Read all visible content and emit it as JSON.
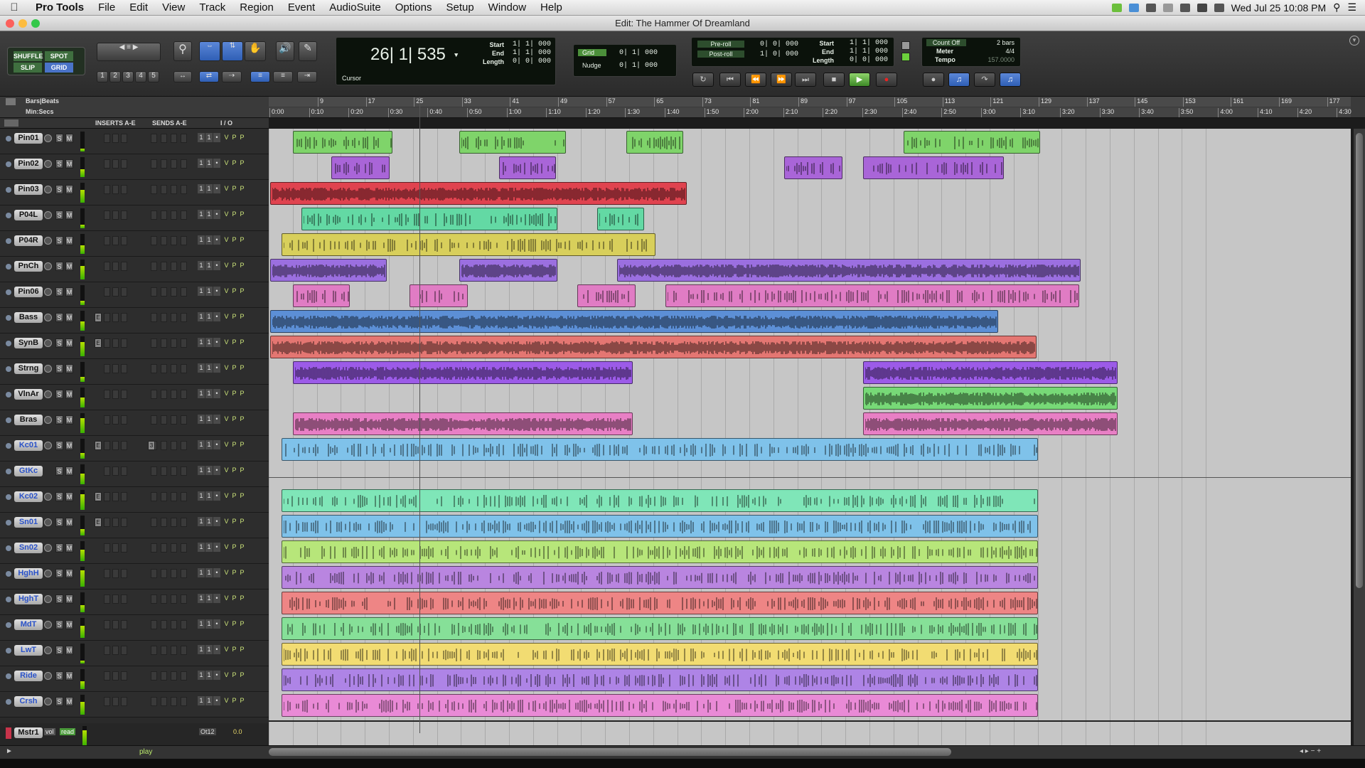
{
  "menubar": {
    "app_name": "Pro Tools",
    "items": [
      "File",
      "Edit",
      "View",
      "Track",
      "Region",
      "Event",
      "AudioSuite",
      "Options",
      "Setup",
      "Window",
      "Help"
    ],
    "clock": "Wed Jul 25  10:08 PM"
  },
  "window": {
    "title": "Edit: The Hammer Of Dreamland"
  },
  "toolbar": {
    "modes": {
      "shuffle": "SHUFFLE",
      "spot": "SPOT",
      "slip": "SLIP",
      "grid": "GRID"
    },
    "zoom_presets": [
      "1",
      "2",
      "3",
      "4",
      "5"
    ],
    "main_counter": "26| 1| 535",
    "cursor_label": "Cursor",
    "selection": {
      "start_label": "Start",
      "start": "1| 1| 000",
      "end_label": "End",
      "end": "1| 1| 000",
      "length_label": "Length",
      "length": "0| 0| 000"
    },
    "grid_label": "Grid",
    "grid_value": "0| 1| 000",
    "nudge_label": "Nudge",
    "nudge_value": "0| 1| 000",
    "preroll_label": "Pre-roll",
    "preroll": "0| 0| 000",
    "postroll_label": "Post-roll",
    "postroll": "1| 0| 000",
    "transport_sel": {
      "start_label": "Start",
      "start": "1| 1| 000",
      "end_label": "End",
      "end": "1| 1| 000",
      "length_label": "Length",
      "length": "0| 0| 000"
    },
    "count_off_label": "Count Off",
    "count_off": "2 bars",
    "meter_label": "Meter",
    "meter": "4/4",
    "tempo_label": "Tempo",
    "tempo": "157.0000"
  },
  "rulers": {
    "bars_label": "Bars|Beats",
    "mins_label": "Min:Secs",
    "bars": [
      "9",
      "17",
      "25",
      "33",
      "41",
      "49",
      "57",
      "65",
      "73",
      "81",
      "89",
      "97",
      "105",
      "113",
      "121",
      "129",
      "137",
      "145",
      "153",
      "161",
      "169",
      "177"
    ],
    "mins": [
      "0:00",
      "0:10",
      "0:20",
      "0:30",
      "0:40",
      "0:50",
      "1:00",
      "1:10",
      "1:20",
      "1:30",
      "1:40",
      "1:50",
      "2:00",
      "2:10",
      "2:20",
      "2:30",
      "2:40",
      "2:50",
      "3:00",
      "3:10",
      "3:20",
      "3:30",
      "3:40",
      "3:50",
      "4:00",
      "4:10",
      "4:20",
      "4:30"
    ]
  },
  "columns": {
    "inserts": "INSERTS A-E",
    "sends": "SENDS A-E",
    "io": "I / O"
  },
  "tracks": [
    {
      "name": "Pin01",
      "color": "#7fd46a",
      "type": "midi"
    },
    {
      "name": "Pin02",
      "color": "#a965d8",
      "type": "midi"
    },
    {
      "name": "Pin03",
      "color": "#e0434f",
      "type": "midi"
    },
    {
      "name": "P04L",
      "color": "#63d9a4",
      "type": "midi"
    },
    {
      "name": "P04R",
      "color": "#d8cf5b",
      "type": "midi"
    },
    {
      "name": "PnCh",
      "color": "#9b6fe0",
      "type": "midi"
    },
    {
      "name": "Pin06",
      "color": "#e07cc4",
      "type": "midi"
    },
    {
      "name": "Bass",
      "color": "#5c8fd6",
      "type": "audio",
      "insert": "E"
    },
    {
      "name": "SynB",
      "color": "#e47672",
      "type": "audio",
      "insert": "E"
    },
    {
      "name": "Strng",
      "color": "#9c5be8",
      "type": "audio"
    },
    {
      "name": "VlnAr",
      "color": "#77d977",
      "type": "audio"
    },
    {
      "name": "Bras",
      "color": "#e87fc5",
      "type": "audio"
    },
    {
      "name": "Kc01",
      "color": "#7fc2ea",
      "type": "inst",
      "insert": "E",
      "send": "3"
    },
    {
      "name": "GtKc",
      "color": "#8a8a8a",
      "type": "inst"
    },
    {
      "name": "Kc02",
      "color": "#7fe6b8",
      "type": "inst",
      "insert": "E"
    },
    {
      "name": "Sn01",
      "color": "#7fc2ea",
      "type": "inst",
      "insert": "E"
    },
    {
      "name": "Sn02",
      "color": "#b7e67a",
      "type": "inst"
    },
    {
      "name": "HghH",
      "color": "#b985e0",
      "type": "inst"
    },
    {
      "name": "HghT",
      "color": "#ee8585",
      "type": "inst"
    },
    {
      "name": "MdT",
      "color": "#86e098",
      "type": "inst"
    },
    {
      "name": "LwT",
      "color": "#f2dc72",
      "type": "inst"
    },
    {
      "name": "Ride",
      "color": "#ae84e6",
      "type": "inst"
    },
    {
      "name": "Crsh",
      "color": "#e98ad6",
      "type": "inst"
    }
  ],
  "master": {
    "name": "Mstr1",
    "vol_label": "vol",
    "read_label": "read",
    "output": "Ot12",
    "value": "0.0"
  },
  "status": {
    "play": "play"
  }
}
